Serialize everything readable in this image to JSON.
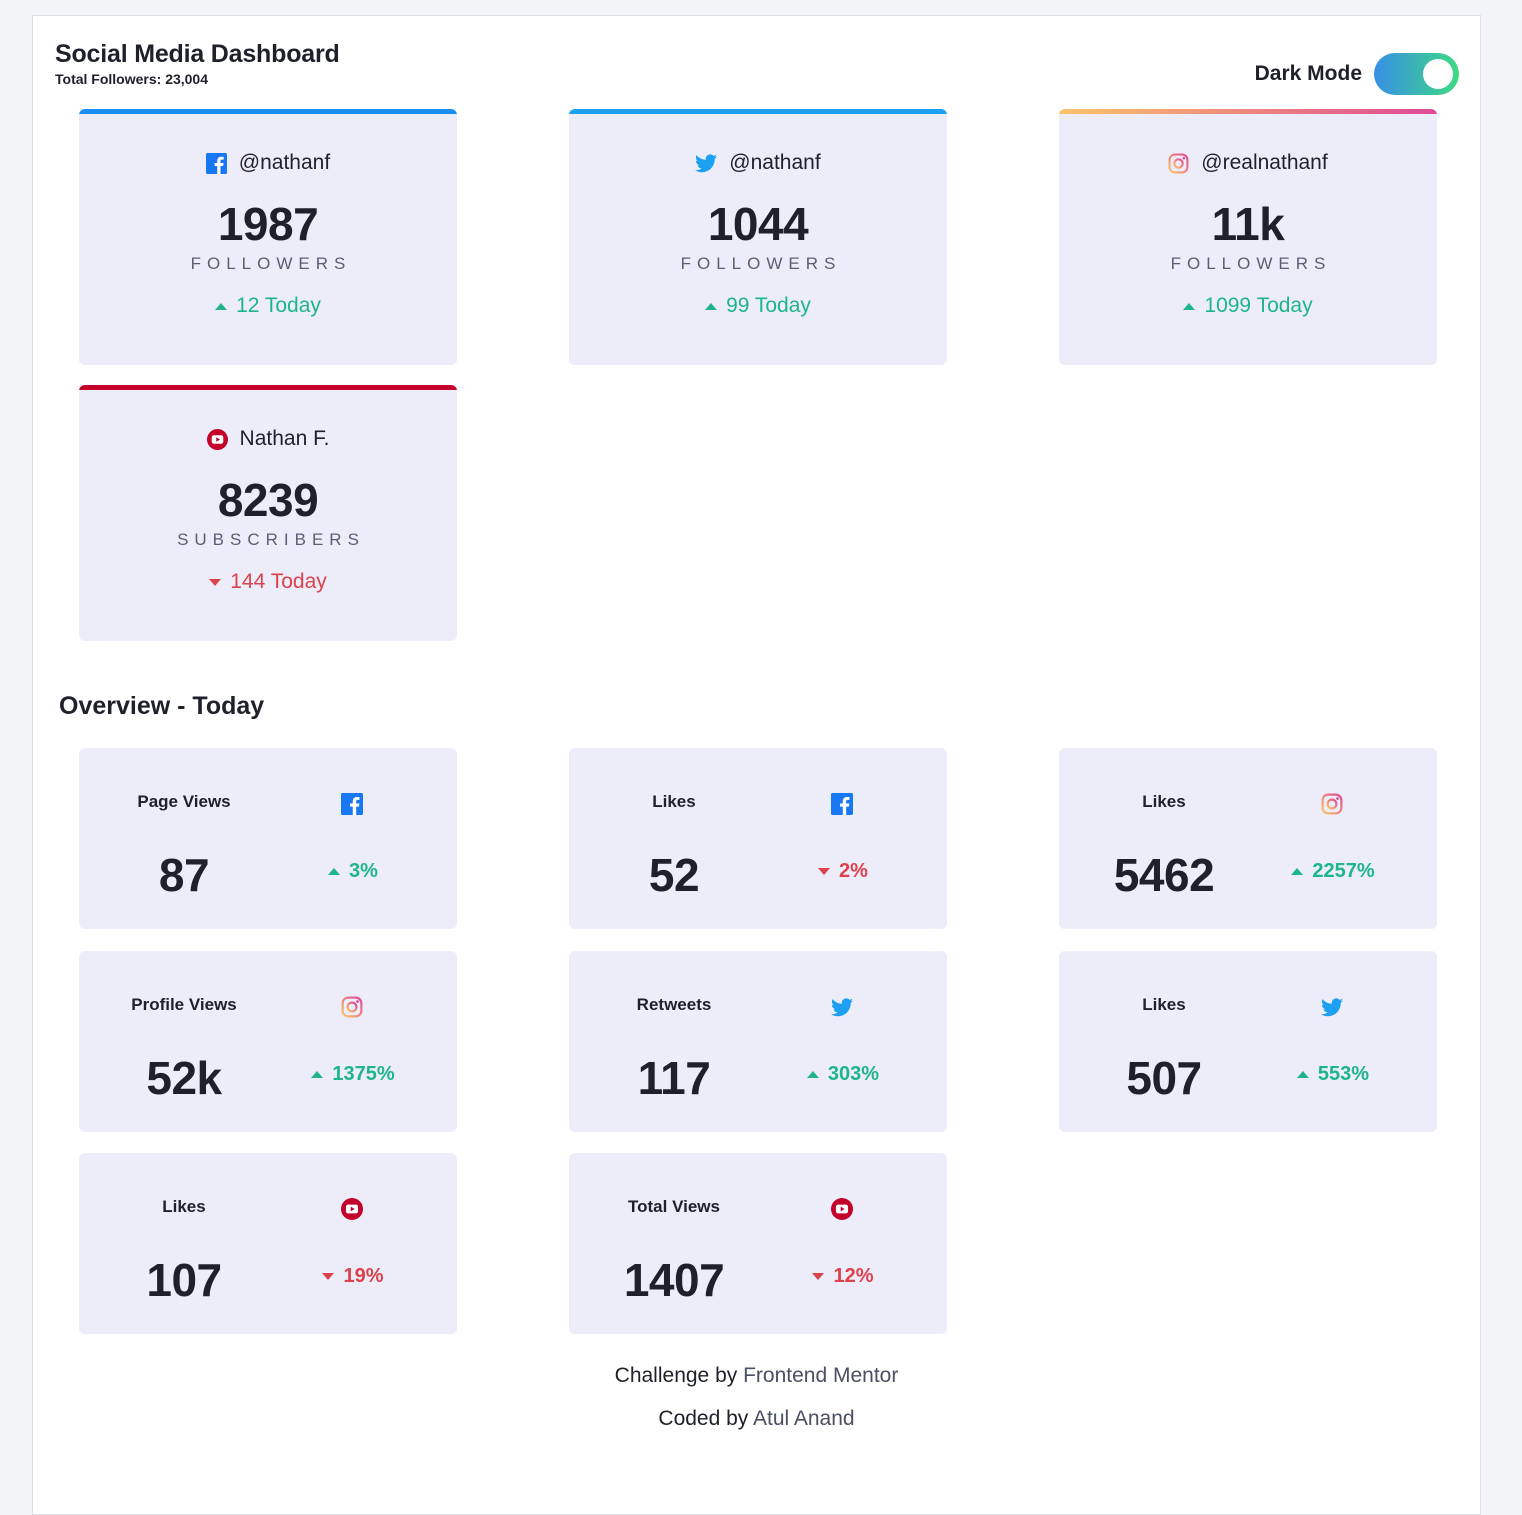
{
  "header": {
    "title": "Social Media Dashboard",
    "total_followers": "Total Followers: 23,004",
    "dark_mode_label": "Dark Mode",
    "dark_mode_on": true
  },
  "follower_cards": [
    {
      "platform": "facebook",
      "icon": "facebook-icon",
      "accent": "#198ff5",
      "handle": "@nathanf",
      "count": "1987",
      "unit": "FOLLOWERS",
      "today": "12 Today",
      "trend": "up"
    },
    {
      "platform": "twitter",
      "icon": "twitter-icon",
      "accent": "#1ca0f2",
      "handle": "@nathanf",
      "count": "1044",
      "unit": "FOLLOWERS",
      "today": "99 Today",
      "trend": "up"
    },
    {
      "platform": "instagram",
      "icon": "instagram-icon",
      "accent": "#df4996",
      "handle": "@realnathanf",
      "count": "11k",
      "unit": "FOLLOWERS",
      "today": "1099 Today",
      "trend": "up"
    },
    {
      "platform": "youtube",
      "icon": "youtube-icon",
      "accent": "#c4032a",
      "handle": "Nathan F.",
      "count": "8239",
      "unit": "SUBSCRIBERS",
      "today": "144 Today",
      "trend": "down"
    }
  ],
  "overview": {
    "title": "Overview - Today",
    "cards": [
      {
        "label": "Page Views",
        "icon": "facebook-icon",
        "value": "87",
        "change": "3%",
        "trend": "up"
      },
      {
        "label": "Likes",
        "icon": "facebook-icon",
        "value": "52",
        "change": "2%",
        "trend": "down"
      },
      {
        "label": "Likes",
        "icon": "instagram-icon",
        "value": "5462",
        "change": "2257%",
        "trend": "up"
      },
      {
        "label": "Profile Views",
        "icon": "instagram-icon",
        "value": "52k",
        "change": "1375%",
        "trend": "up"
      },
      {
        "label": "Retweets",
        "icon": "twitter-icon",
        "value": "117",
        "change": "303%",
        "trend": "up"
      },
      {
        "label": "Likes",
        "icon": "twitter-icon",
        "value": "507",
        "change": "553%",
        "trend": "up"
      },
      {
        "label": "Likes",
        "icon": "youtube-icon",
        "value": "107",
        "change": "19%",
        "trend": "down"
      },
      {
        "label": "Total Views",
        "icon": "youtube-icon",
        "value": "1407",
        "change": "12%",
        "trend": "down"
      }
    ]
  },
  "footer": {
    "challenge_prefix": "Challenge by",
    "challenge_link": "Frontend Mentor",
    "coded_prefix": "Coded by",
    "coded_link": "Atul Anand"
  },
  "colors": {
    "up": "#1eb589",
    "down": "#dc414c",
    "card_bg": "#ecedf8",
    "toggle_gradient": [
      "#378fe6",
      "#3eda82"
    ]
  }
}
